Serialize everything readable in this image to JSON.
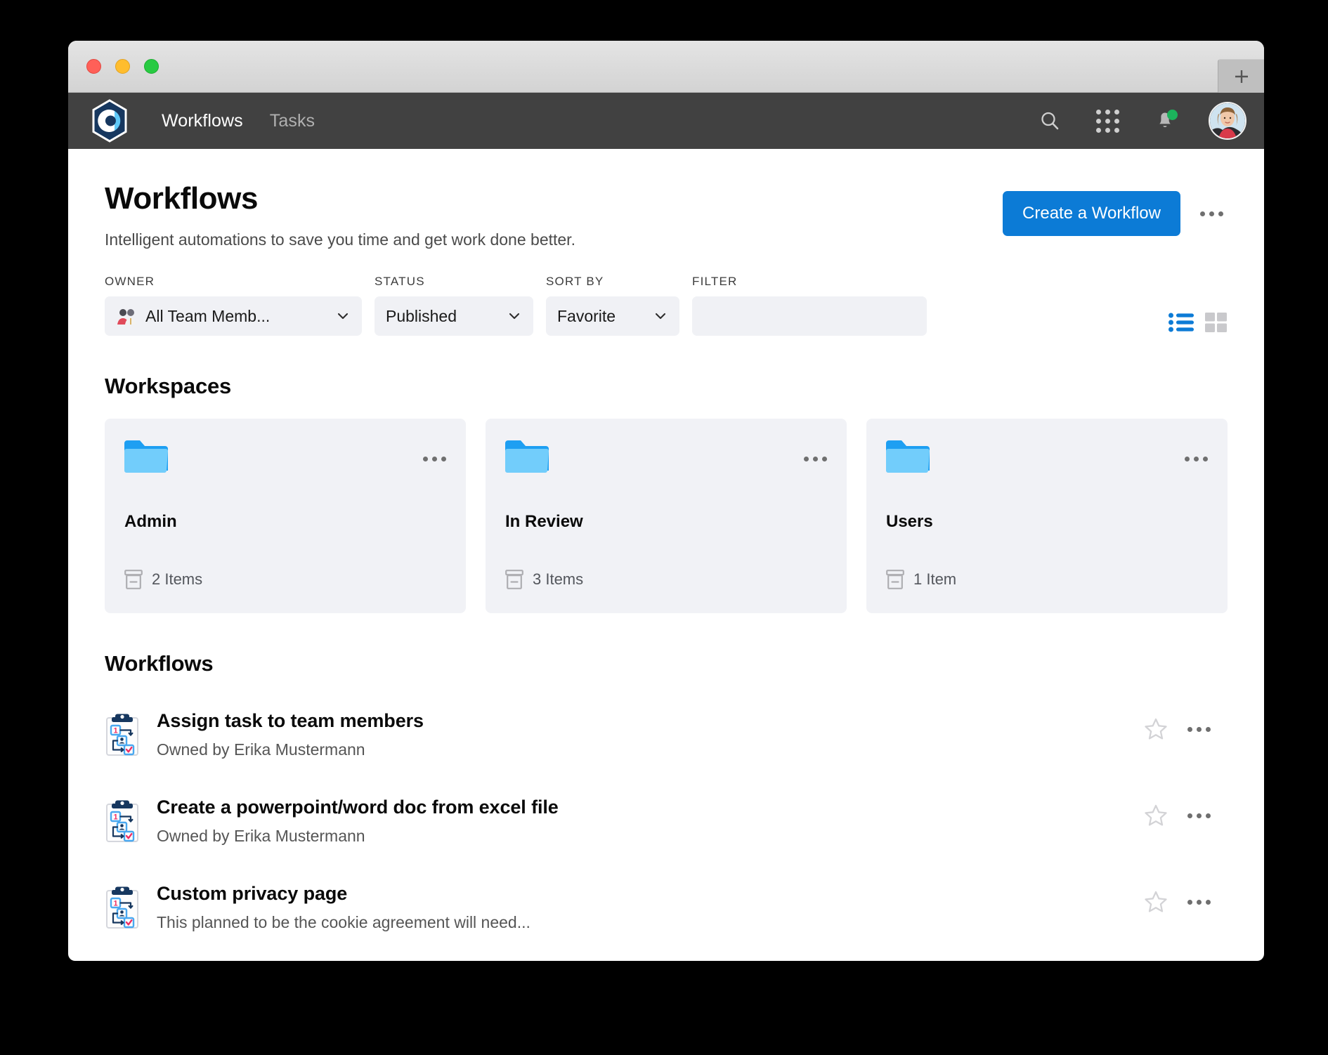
{
  "browser": {
    "traffic_lights": [
      "close",
      "minimize",
      "zoom"
    ],
    "new_tab_label": "+"
  },
  "nav": {
    "logo_name": "app-logo",
    "links": [
      {
        "label": "Workflows",
        "active": true
      },
      {
        "label": "Tasks",
        "active": false
      }
    ],
    "icons": {
      "search": "search-icon",
      "apps": "apps-grid-icon",
      "notifications": "bell-icon",
      "avatar": "user-avatar"
    },
    "notification_badge": true,
    "bg_color": "#414141"
  },
  "header": {
    "title": "Workflows",
    "subtitle": "Intelligent automations to save you time and get work done better.",
    "primary_button": "Create a Workflow",
    "overflow_label": "More options",
    "accent_color": "#0c7bd6"
  },
  "filters": {
    "owner": {
      "label": "OWNER",
      "value": "All Team Memb..."
    },
    "status": {
      "label": "STATUS",
      "value": "Published"
    },
    "sort_by": {
      "label": "SORT BY",
      "value": "Favorite"
    },
    "filter": {
      "label": "FILTER",
      "value": "",
      "placeholder": ""
    },
    "view": {
      "list_active": true,
      "grid_active": false
    }
  },
  "workspaces": {
    "heading": "Workspaces",
    "cards": [
      {
        "name": "Admin",
        "items": "2 Items"
      },
      {
        "name": "In Review",
        "items": "3 Items"
      },
      {
        "name": "Users",
        "items": "1 Item"
      }
    ]
  },
  "workflows": {
    "heading": "Workflows",
    "rows": [
      {
        "title": "Assign task to team members",
        "subtitle": "Owned by Erika Mustermann",
        "favorite": false
      },
      {
        "title": "Create a powerpoint/word doc from excel file",
        "subtitle": "Owned by Erika Mustermann",
        "favorite": false
      },
      {
        "title": "Custom privacy page",
        "subtitle": "This planned to be the cookie agreement will need...",
        "favorite": false
      }
    ]
  }
}
